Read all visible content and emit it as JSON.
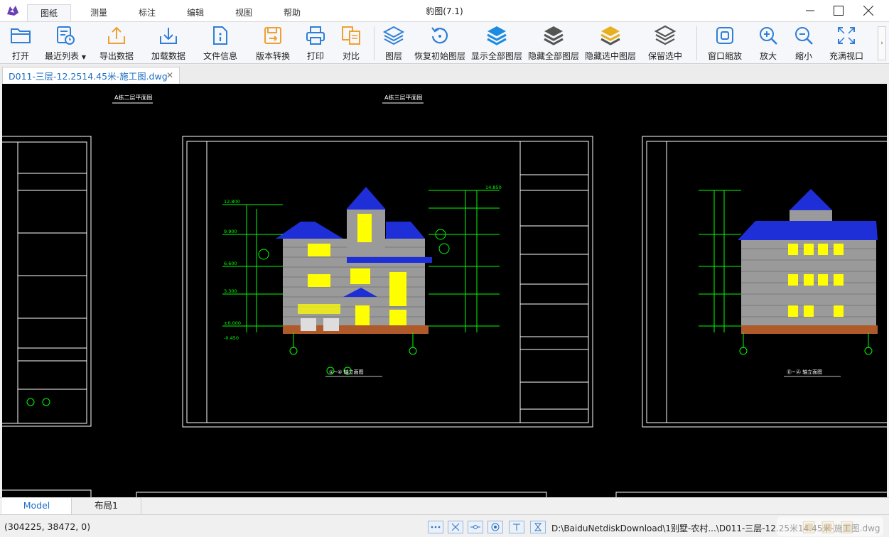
{
  "app": {
    "title": "豹图(7.1)",
    "logo": "leopard-logo-icon"
  },
  "menu_tabs": [
    {
      "label": "图纸",
      "active": true
    },
    {
      "label": "测量",
      "active": false
    },
    {
      "label": "标注",
      "active": false
    },
    {
      "label": "编辑",
      "active": false
    },
    {
      "label": "视图",
      "active": false
    },
    {
      "label": "帮助",
      "active": false
    }
  ],
  "window_controls": [
    "minimize-icon",
    "maximize-icon",
    "close-icon"
  ],
  "toolbar": {
    "items": [
      {
        "label": "打开",
        "icon": "folder-open-icon"
      },
      {
        "label": "最近列表",
        "icon": "recent-list-icon",
        "has_dropdown": true
      },
      {
        "label": "导出数据",
        "icon": "export-icon"
      },
      {
        "label": "加载数据",
        "icon": "import-icon"
      },
      {
        "label": "文件信息",
        "icon": "file-info-icon"
      },
      {
        "label": "版本转换",
        "icon": "version-convert-icon"
      },
      {
        "label": "打印",
        "icon": "printer-icon"
      },
      {
        "label": "对比",
        "icon": "compare-icon"
      },
      {
        "label": "图层",
        "icon": "layers-icon"
      },
      {
        "label": "恢复初始图层",
        "icon": "restore-layers-icon"
      },
      {
        "label": "显示全部图层",
        "icon": "show-all-layers-icon"
      },
      {
        "label": "隐藏全部图层",
        "icon": "hide-all-layers-icon"
      },
      {
        "label": "隐藏选中图层",
        "icon": "hide-selected-layers-icon"
      },
      {
        "label": "保留选中",
        "icon": "keep-selected-layers-icon"
      },
      {
        "label": "窗口缩放",
        "icon": "window-zoom-icon"
      },
      {
        "label": "放大",
        "icon": "zoom-in-icon"
      },
      {
        "label": "缩小",
        "icon": "zoom-out-icon"
      },
      {
        "label": "充满视口",
        "icon": "fit-viewport-icon"
      }
    ]
  },
  "document_tab": {
    "label": "D011-三层-12.2514.45米-施工图.dwg",
    "close_icon": "close-icon"
  },
  "drawing": {
    "sheet_titles": [
      "A栋二层平面图",
      "A栋三层平面图"
    ],
    "elevation_labels": [
      "①~④ 轴立面图",
      "Ⓓ~Ⓐ 轴立面图"
    ],
    "level_marks": [
      "14.850",
      "12.800",
      "9.900",
      "6.600",
      "3.300",
      "±0.000",
      "-0.450"
    ],
    "colors": {
      "background": "#000000",
      "frame": "#ffffff",
      "roof": "#1f2fd8",
      "window": "#ffff00",
      "dimension": "#00ff00",
      "base": "#b05a2a"
    }
  },
  "layout_tabs": [
    {
      "label": "Model",
      "active": true
    },
    {
      "label": "布局1",
      "active": false
    }
  ],
  "status": {
    "coordinates": "(304225, 38472, 0)",
    "buttons": [
      "grid-snap-icon",
      "cross-snap-icon",
      "midpoint-snap-icon",
      "center-snap-icon",
      "perpendicular-snap-icon",
      "hourglass-icon"
    ],
    "file_path": "D:\\BaiduNetdiskDownload\\1别墅-农村...\\D011-三层-12.25米14.45米-施工图.dwg"
  }
}
